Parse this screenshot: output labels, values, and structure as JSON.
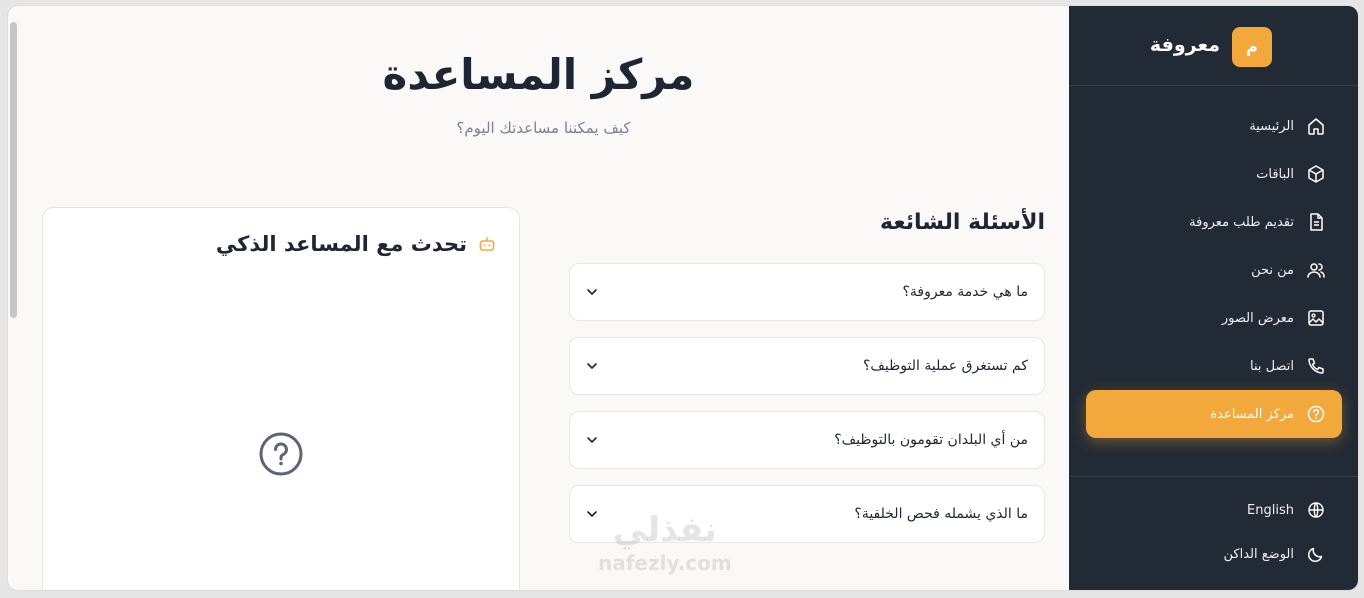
{
  "brand": {
    "logo_letter": "م",
    "name": "معروفة"
  },
  "nav": [
    {
      "label": "الرئيسية",
      "icon": "home-icon",
      "active": false
    },
    {
      "label": "الباقات",
      "icon": "package-icon",
      "active": false
    },
    {
      "label": "تقديم طلب معروفة",
      "icon": "document-icon",
      "active": false
    },
    {
      "label": "من نحن",
      "icon": "users-icon",
      "active": false
    },
    {
      "label": "معرض الصور",
      "icon": "image-icon",
      "active": false
    },
    {
      "label": "اتصل بنا",
      "icon": "phone-icon",
      "active": false
    },
    {
      "label": "مركز المساعدة",
      "icon": "help-icon",
      "active": true
    }
  ],
  "bottom": {
    "language_label": "English",
    "dark_mode_label": "الوضع الداكن"
  },
  "main": {
    "title": "مركز المساعدة",
    "subtitle": "كيف يمكننا مساعدتك اليوم؟",
    "faq_title": "الأسئلة الشائعة",
    "faq": [
      "ما هي خدمة معروفة؟",
      "كم تستغرق عملية التوظيف؟",
      "من أي البلدان تقومون بالتوظيف؟",
      "ما الذي يشمله فحص الخلفية؟"
    ],
    "chat_title": "تحدث مع المساعد الذكي"
  },
  "watermark": {
    "arabic": "نفذلي",
    "latin": "nafezly.com"
  },
  "colors": {
    "accent": "#f2a83a",
    "sidebar_bg": "#222a35",
    "page_bg": "#faf9f8",
    "text": "#1f2633"
  }
}
